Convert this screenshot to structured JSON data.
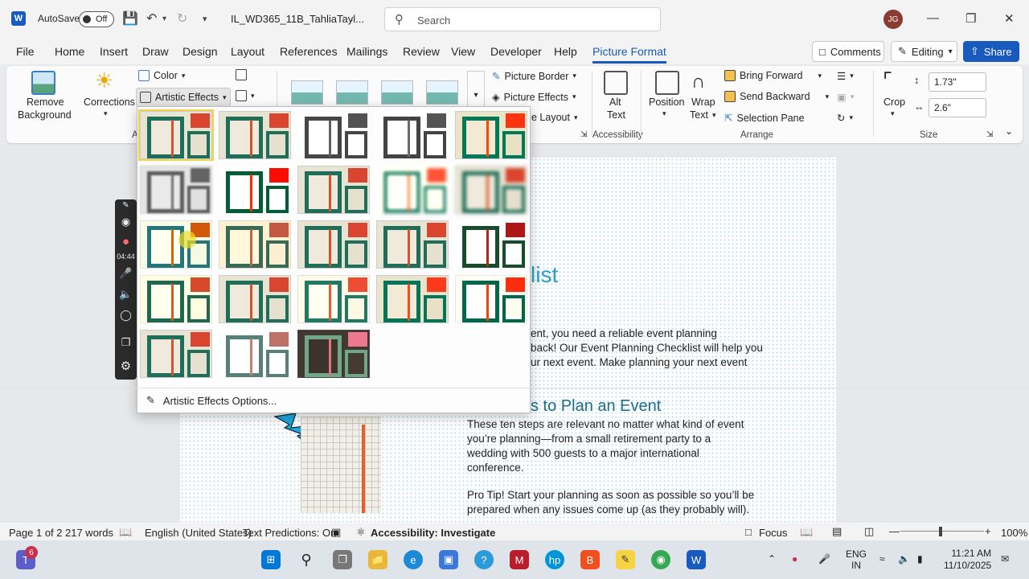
{
  "titlebar": {
    "autosave_label": "AutoSave",
    "autosave_state": "Off",
    "doc_name": "IL_WD365_11B_TahliaTayl...",
    "search_placeholder": "Search",
    "user_initials": "JG"
  },
  "tabs": [
    "File",
    "Home",
    "Insert",
    "Draw",
    "Design",
    "Layout",
    "References",
    "Mailings",
    "Review",
    "View",
    "Developer",
    "Help",
    "Picture Format"
  ],
  "active_tab": "Picture Format",
  "top_buttons": {
    "comments": "Comments",
    "editing": "Editing",
    "share": "Share"
  },
  "ribbon": {
    "remove_background": [
      "Remove",
      "Background"
    ],
    "corrections": "Corrections",
    "color": "Color",
    "artistic_effects": "Artistic Effects",
    "adjust_label_partial": "A",
    "picture_border": "Picture Border",
    "picture_effects": "Picture Effects",
    "picture_layout_partial": "e Layout",
    "alt_text": [
      "Alt",
      "Text"
    ],
    "accessibility_label": "Accessibility",
    "position": "Position",
    "wrap_text": [
      "Wrap",
      "Text"
    ],
    "bring_forward": "Bring Forward",
    "send_backward": "Send Backward",
    "selection_pane": "Selection Pane",
    "arrange_label": "Arrange",
    "crop": "Crop",
    "height": "1.73\"",
    "width": "2.6\"",
    "size_label": "Size"
  },
  "dropdown": {
    "option_label": "Artistic Effects Options..."
  },
  "document": {
    "heading_partial": "list",
    "para1": [
      "ent, you need a reliable event planning",
      "back! Our Event Planning Checklist will help you",
      "ur next event. Make planning your next event"
    ],
    "subheading_partial": "s to Plan an Event",
    "para2": [
      "These ten steps are relevant no matter what kind of event",
      "you’re planning—from a small retirement party to a",
      "wedding with 500 guests to a major international",
      "conference."
    ],
    "para3": [
      "Pro Tip! Start your planning as soon as possible so you’ll be",
      "prepared when any issues come up (as they probably will)."
    ]
  },
  "recorder": {
    "timer": "04:44"
  },
  "statusbar": {
    "page": "Page 1 of 2",
    "words": "217 words",
    "language": "English (United States)",
    "predictions": "Text Predictions: On",
    "accessibility": "Accessibility: Investigate",
    "focus": "Focus",
    "zoom": "100%"
  },
  "taskbar": {
    "teams_badge": "6",
    "lang_top": "ENG",
    "lang_bottom": "IN",
    "time": "11:21 AM",
    "date": "11/10/2025"
  },
  "colors": {
    "accent": "#185abd",
    "heading": "#2aa0c8"
  }
}
